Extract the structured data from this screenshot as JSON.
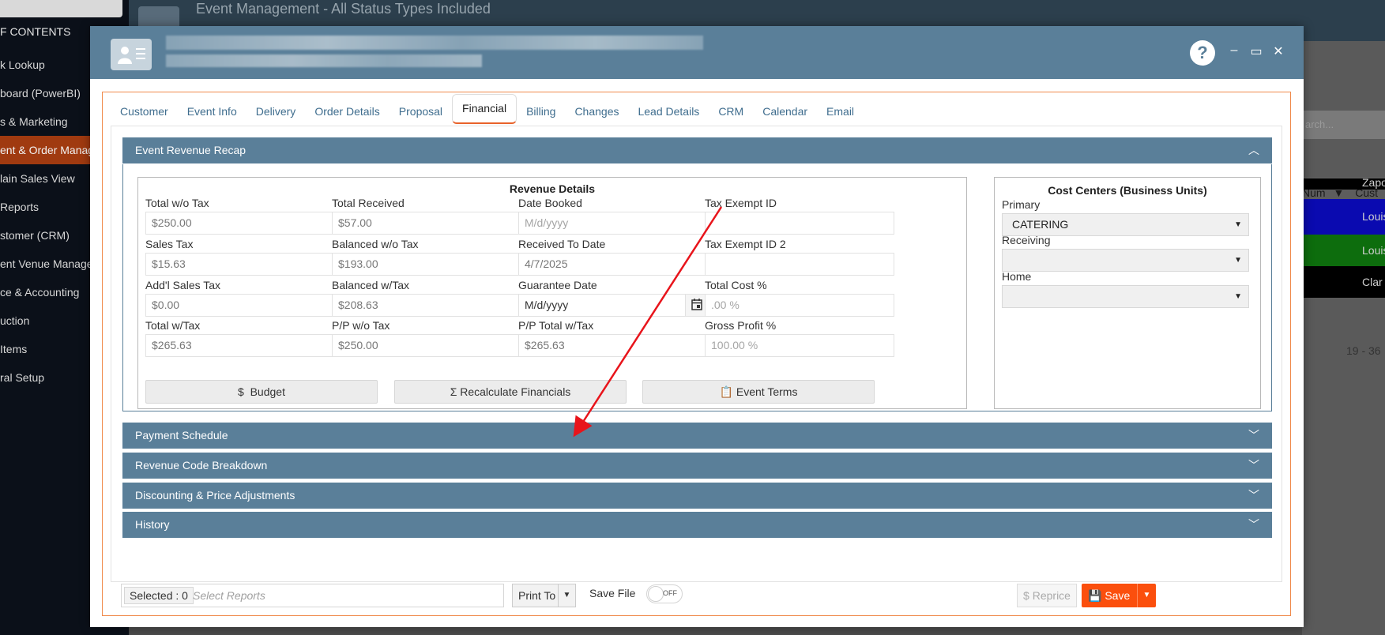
{
  "background": {
    "toc_label": "F CONTENTS",
    "menu_items": [
      {
        "label": "k Lookup"
      },
      {
        "label": "board (PowerBI)"
      },
      {
        "label": "s & Marketing"
      },
      {
        "label": "ent & Order Manag"
      },
      {
        "label": "lain Sales View"
      },
      {
        "label": "Reports"
      },
      {
        "label": "stomer (CRM)"
      },
      {
        "label": "ent Venue Manage"
      },
      {
        "label": "ce & Accounting"
      },
      {
        "label": "uction"
      },
      {
        "label": "Items"
      },
      {
        "label": "ral Setup"
      }
    ],
    "app_title": "Event Management - All Status Types Included",
    "right_search_placeholder": "arch...",
    "right_col1": "Num",
    "right_col2": "Cust",
    "right_rows": [
      "Zapo",
      "Louis",
      "Louis",
      "Clar"
    ],
    "right_count": "19 - 36"
  },
  "modal": {
    "window_controls": {
      "help": "?",
      "minimize": "–",
      "maximize": "▭",
      "close": "✕"
    },
    "tabs": [
      {
        "label": "Customer"
      },
      {
        "label": "Event Info"
      },
      {
        "label": "Delivery"
      },
      {
        "label": "Order Details"
      },
      {
        "label": "Proposal"
      },
      {
        "label": "Financial"
      },
      {
        "label": "Billing"
      },
      {
        "label": "Changes"
      },
      {
        "label": "Lead Details"
      },
      {
        "label": "CRM"
      },
      {
        "label": "Calendar"
      },
      {
        "label": "Email"
      }
    ],
    "active_tab": "Financial",
    "sections": {
      "recap": "Event Revenue Recap",
      "payment": "Payment Schedule",
      "revenue_code": "Revenue Code Breakdown",
      "discounting": "Discounting & Price Adjustments",
      "history": "History"
    },
    "revenue_details": {
      "title": "Revenue Details",
      "total_wo_tax": {
        "label": "Total w/o Tax",
        "value": "$250.00"
      },
      "total_received": {
        "label": "Total Received",
        "value": "$57.00"
      },
      "date_booked": {
        "label": "Date Booked",
        "placeholder": "M/d/yyyy"
      },
      "tax_exempt_id": {
        "label": "Tax Exempt ID",
        "value": ""
      },
      "sales_tax": {
        "label": "Sales Tax",
        "value": "$15.63"
      },
      "balanced_wo_tax": {
        "label": "Balanced w/o Tax",
        "value": "$193.00"
      },
      "received_to_date": {
        "label": "Received To Date",
        "value": "4/7/2025"
      },
      "tax_exempt_id2": {
        "label": "Tax Exempt ID 2",
        "value": ""
      },
      "addl_sales_tax": {
        "label": "Add'l Sales Tax",
        "value": "$0.00"
      },
      "balanced_w_tax": {
        "label": "Balanced w/Tax",
        "value": "$208.63"
      },
      "guarantee_date": {
        "label": "Guarantee Date",
        "value": "M/d/yyyy"
      },
      "total_cost_pct": {
        "label": "Total Cost %",
        "placeholder": ".00 %"
      },
      "total_w_tax": {
        "label": "Total w/Tax",
        "value": "$265.63"
      },
      "pp_wo_tax": {
        "label": "P/P w/o Tax",
        "value": "$250.00"
      },
      "pp_total_w_tax": {
        "label": "P/P Total w/Tax",
        "value": "$265.63"
      },
      "gross_profit_pct": {
        "label": "Gross Profit %",
        "value": "100.00 %"
      }
    },
    "buttons": {
      "budget": "Budget",
      "recalc": "Recalculate Financials",
      "terms": "Event Terms"
    },
    "cost_centers": {
      "title": "Cost Centers (Business Units)",
      "primary": {
        "label": "Primary",
        "value": "CATERING"
      },
      "receiving": {
        "label": "Receiving",
        "value": ""
      },
      "home": {
        "label": "Home",
        "value": ""
      }
    },
    "footer": {
      "selected": "Selected : 0",
      "reports_placeholder": "Select Reports",
      "print_to": "Print To",
      "save_file": "Save File",
      "toggle_state": "OFF",
      "reprice": "Reprice",
      "save": "Save"
    }
  }
}
